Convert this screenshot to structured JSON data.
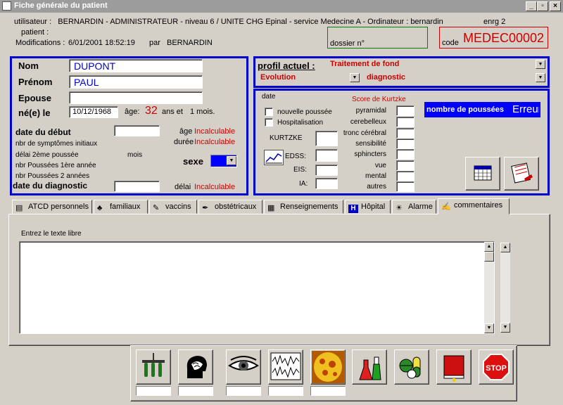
{
  "window": {
    "title": "Fiche générale du patient"
  },
  "header": {
    "utilisateur_label": "utilisateur :",
    "utilisateur_value": "BERNARDIN - ADMINISTRATEUR - niveau 6 / UNITE CHG Epinal - service Medecine A - Ordinateur : bernardin",
    "enrg": "enrg  2",
    "patient_label": "patient :",
    "modifications_label": "Modifications :",
    "modifications_date": "6/01/2001 18:52:19",
    "par_label": "par",
    "par_value": "BERNARDIN",
    "dossier_label": "dossier n°",
    "code_label": "code",
    "code_value": "MEDEC00002"
  },
  "identity": {
    "nom_label": "Nom",
    "nom_value": "DUPONT",
    "prenom_label": "Prénom",
    "prenom_value": "PAUL",
    "epouse_label": "Epouse",
    "ne_label": "né(e) le",
    "ne_value": "10/12/1968",
    "age_label": "âge:",
    "age_value": "32",
    "age_suffix": "ans et",
    "age_months": "1 mois.",
    "date_debut_label": "date du début",
    "age_debut_label": "âge",
    "age_debut_value": "Incalculable",
    "symptomes_label": "nbr de symptômes initiaux",
    "duree_label": "durée",
    "duree_value": "Incalculable",
    "delai2_label": "délai 2ème poussée",
    "mois_label": "mois",
    "pousses1_label": "nbr Poussées 1ère année",
    "sexe_label": "sexe",
    "pousses2_label": "nbr Poussées 2 années",
    "date_diag_label": "date du diagnostic",
    "delai_label": "délai",
    "delai_value": "Incalculable"
  },
  "profil": {
    "profil_label": "profil  actuel :",
    "traitement": "Traitement de fond",
    "evolution": "Evolution",
    "diagnostic": "diagnostic"
  },
  "scores": {
    "date_label": "date",
    "kurtzke_title": "Score de Kurtzke",
    "nouvelle_poussee": "nouvelle poussée",
    "hospitalisation": "Hospitalisation",
    "kurtzke": "KURTZKE",
    "edss": "EDSS:",
    "eis": "EIS:",
    "ia": "IA:",
    "nombre_poussees_label": "nombre de poussées",
    "nombre_poussees_value": "Erreur",
    "items": [
      "pyramidal",
      "cerebelleux",
      "tronc cérébral",
      "sensibilité",
      "sphincters",
      "vue",
      "mental",
      "autres"
    ]
  },
  "tabs": [
    {
      "label": "ATCD personnels",
      "icon": "folder-icon"
    },
    {
      "label": "familiaux",
      "icon": "family-tree-icon"
    },
    {
      "label": "vaccins",
      "icon": "syringe-icon"
    },
    {
      "label": "obstétricaux",
      "icon": "pen-icon"
    },
    {
      "label": "Renseignements",
      "icon": "document-icon"
    },
    {
      "label": "Hôpital",
      "icon": "hospital-icon"
    },
    {
      "label": "Alarme",
      "icon": "sun-icon"
    },
    {
      "label": "commentaires",
      "icon": "comment-icon"
    }
  ],
  "comment": {
    "label": "Entrez le texte libre"
  },
  "toolbar": {
    "buttons": [
      "lab-tubes-icon",
      "brain-scan-icon",
      "eye-icon",
      "eeg-wave-icon",
      "mri-image-icon",
      "chemistry-flask-icon",
      "pills-icon",
      "book-icon",
      "stop-icon"
    ],
    "stop_label": "STOP"
  },
  "colors": {
    "accent": "#0000cc",
    "alert": "#cc0000",
    "face": "#d4d0c8"
  }
}
